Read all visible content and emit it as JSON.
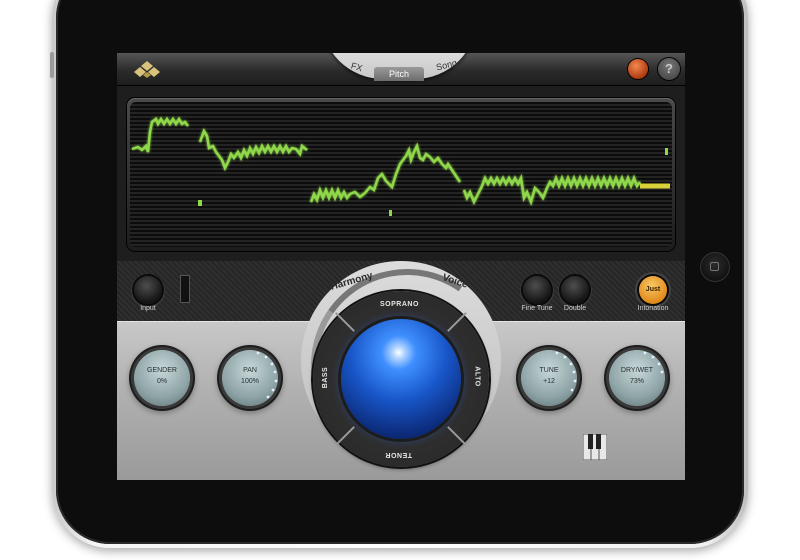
{
  "nav": {
    "tabs": [
      {
        "label": "FX"
      },
      {
        "label": "Pitch",
        "active": true
      },
      {
        "label": "Song"
      }
    ]
  },
  "header": {
    "help_label": "?",
    "accent_color": "#c4461a"
  },
  "controls": {
    "input_label": "Input",
    "fine_tune_label": "Fine Tune",
    "double_label": "Double",
    "just_label": "Just",
    "intonation_label": "Intonation"
  },
  "harmony": {
    "mode_harmony": "Harmony",
    "mode_voice": "Voice",
    "voices": {
      "top": "SOPRANO",
      "right": "ALTO",
      "bottom": "TENOR",
      "left": "BASS"
    },
    "orb_color": "#2a6ee8"
  },
  "knobs": [
    {
      "label": "GENDER",
      "value": "0%"
    },
    {
      "label": "PAN",
      "value": "100%"
    },
    {
      "label": "TUNE",
      "value": "+12"
    },
    {
      "label": "DRY/WET",
      "value": "73%"
    }
  ],
  "display": {
    "trace_color": "#8fd84a",
    "flat_color": "#d8d23a"
  },
  "icons": {
    "logo": "diamond-logo-icon",
    "settings": "orange-record-icon",
    "help": "help-icon",
    "keyboard": "piano-keys-icon"
  }
}
